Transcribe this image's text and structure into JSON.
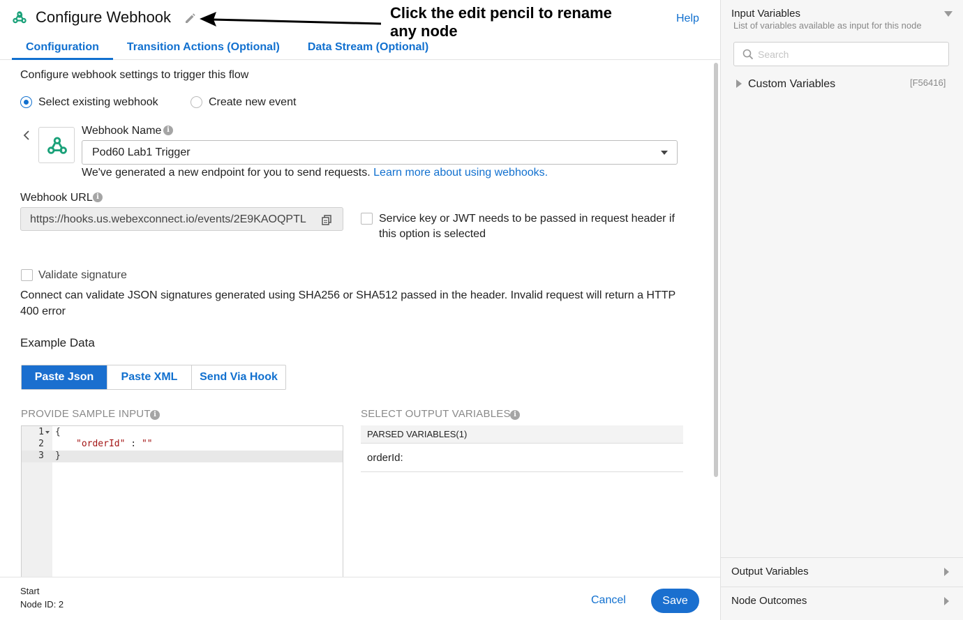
{
  "header": {
    "title": "Configure Webhook",
    "callout": "Click the edit pencil to rename any node",
    "help_label": "Help"
  },
  "tabs": [
    {
      "label": "Configuration",
      "active": true
    },
    {
      "label": "Transition Actions (Optional)",
      "active": false
    },
    {
      "label": "Data Stream (Optional)",
      "active": false
    }
  ],
  "config": {
    "intro": "Configure webhook settings to trigger this flow",
    "radio_existing": "Select existing webhook",
    "radio_new": "Create new event",
    "selected_radio": "existing",
    "webhook_name_label": "Webhook Name",
    "webhook_name_value": "Pod60 Lab1 Trigger",
    "endpoint_note": "We've generated a new endpoint for you to send requests.",
    "learn_more_link": "Learn more about using webhooks.",
    "webhook_url_label": "Webhook URL",
    "webhook_url_value": "https://hooks.us.webexconnect.io/events/2E9KAOQPTL",
    "service_key_label": "Service key or JWT needs to be passed in request header if this option is selected",
    "service_key_checked": false,
    "validate_label": "Validate signature",
    "validate_checked": false,
    "validate_note": "Connect can validate JSON signatures generated using SHA256 or SHA512 passed in the header. Invalid request will return a HTTP 400 error",
    "example_heading": "Example Data",
    "segments": [
      {
        "label": "Paste Json",
        "active": true
      },
      {
        "label": "Paste XML",
        "active": false
      },
      {
        "label": "Send Via Hook",
        "active": false
      }
    ],
    "sample_input_label": "PROVIDE SAMPLE INPUT",
    "code_lines": [
      {
        "n": "1",
        "text": "{"
      },
      {
        "n": "2",
        "key": "\"orderId\"",
        "sep": " : ",
        "value": "\"\""
      },
      {
        "n": "3",
        "text": "}"
      }
    ],
    "output_label": "SELECT OUTPUT VARIABLES",
    "parsed_header": "PARSED VARIABLES(1)",
    "parsed_rows": [
      "orderId:"
    ]
  },
  "footer": {
    "node_name": "Start",
    "node_id": "Node ID: 2",
    "cancel_label": "Cancel",
    "save_label": "Save"
  },
  "sidebar": {
    "title": "Input Variables",
    "subtitle": "List of variables available as input for this node",
    "search_placeholder": "Search",
    "custom_variables_label": "Custom Variables",
    "custom_variables_code": "[F56416]",
    "output_variables_label": "Output Variables",
    "node_outcomes_label": "Node Outcomes"
  },
  "colors": {
    "accent": "#1170cf",
    "primary_button": "#1a6fcf",
    "brand_icon": "#1aa179"
  }
}
